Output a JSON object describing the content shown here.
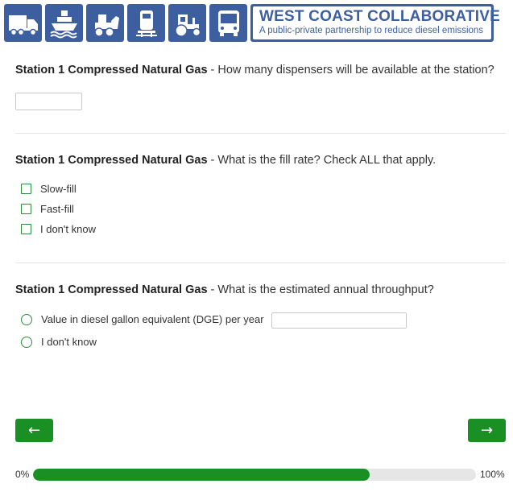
{
  "header": {
    "tiles": [
      "truck-icon",
      "ship-icon",
      "loader-icon",
      "locomotive-icon",
      "tractor-icon",
      "bus-icon"
    ],
    "brand_title": "WEST COAST COLLABORATIVE",
    "brand_tagline": "A public-private partnership to reduce diesel emissions",
    "brand_color": "#3e5f9f"
  },
  "questions": [
    {
      "prefix": "Station 1 Compressed Natural Gas",
      "text": " - How many dispensers will be available at the station?",
      "input_value": ""
    },
    {
      "prefix": "Station 1 Compressed Natural Gas",
      "text": " - What is the fill rate? Check ALL that apply.",
      "options": [
        "Slow-fill",
        "Fast-fill",
        "I don't know"
      ]
    },
    {
      "prefix": "Station 1 Compressed Natural Gas",
      "text": " - What is the estimated annual throughput?",
      "options": [
        "Value in diesel gallon equivalent (DGE) per year",
        "I don't know"
      ],
      "input_value": ""
    }
  ],
  "nav": {
    "back_label": "←",
    "next_label": "→",
    "accent": "#1a8f24"
  },
  "progress": {
    "start_label": "0%",
    "end_label": "100%",
    "fraction": 0.76
  }
}
